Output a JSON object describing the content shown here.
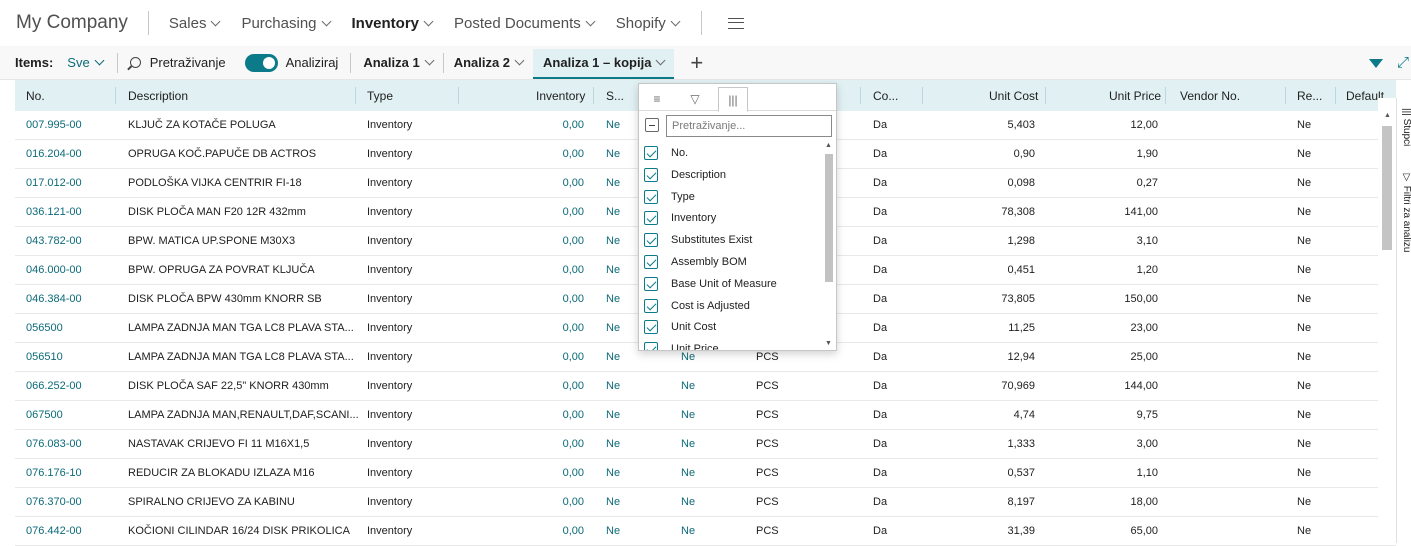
{
  "company": "My Company",
  "nav": [
    {
      "label": "Sales",
      "active": false
    },
    {
      "label": "Purchasing",
      "active": false
    },
    {
      "label": "Inventory",
      "active": true
    },
    {
      "label": "Posted Documents",
      "active": false
    },
    {
      "label": "Shopify",
      "active": false
    }
  ],
  "actionbar": {
    "label": "Items:",
    "filter": "Sve",
    "search": "Pretraživanje",
    "analyze": "Analiziraj",
    "tabs": [
      "Analiza 1",
      "Analiza 2",
      "Analiza 1 – kopija"
    ],
    "add": "+"
  },
  "table": {
    "headers": [
      "No.",
      "Description",
      "Type",
      "Inventory",
      "S...",
      "Co...",
      "Unit Cost",
      "Unit Price",
      "Vendor No.",
      "Re...",
      "Default"
    ],
    "rows": [
      {
        "no": "007.995-00",
        "desc": "KLJUČ ZA KOTAČE POLUGA",
        "type": "Inventory",
        "inv": "0,00",
        "s": "Ne",
        "a": "",
        "u": "",
        "co": "Da",
        "cost": "5,403",
        "price": "12,00",
        "re": "Ne"
      },
      {
        "no": "016.204-00",
        "desc": "OPRUGA KOČ.PAPUČE DB ACTROS",
        "type": "Inventory",
        "inv": "0,00",
        "s": "Ne",
        "a": "",
        "u": "",
        "co": "Da",
        "cost": "0,90",
        "price": "1,90",
        "re": "Ne"
      },
      {
        "no": "017.012-00",
        "desc": "PODLOŠKA VIJKA CENTRIR FI-18",
        "type": "Inventory",
        "inv": "0,00",
        "s": "Ne",
        "a": "",
        "u": "",
        "co": "Da",
        "cost": "0,098",
        "price": "0,27",
        "re": "Ne"
      },
      {
        "no": "036.121-00",
        "desc": "DISK PLOČA MAN F20 12R 432mm",
        "type": "Inventory",
        "inv": "0,00",
        "s": "Ne",
        "a": "",
        "u": "",
        "co": "Da",
        "cost": "78,308",
        "price": "141,00",
        "re": "Ne"
      },
      {
        "no": "043.782-00",
        "desc": "BPW. MATICA UP.SPONE M30X3",
        "type": "Inventory",
        "inv": "0,00",
        "s": "Ne",
        "a": "",
        "u": "",
        "co": "Da",
        "cost": "1,298",
        "price": "3,10",
        "re": "Ne"
      },
      {
        "no": "046.000-00",
        "desc": "BPW. OPRUGA ZA POVRAT KLJUČA",
        "type": "Inventory",
        "inv": "0,00",
        "s": "Ne",
        "a": "",
        "u": "",
        "co": "Da",
        "cost": "0,451",
        "price": "1,20",
        "re": "Ne"
      },
      {
        "no": "046.384-00",
        "desc": "DISK PLOČA BPW 430mm KNORR SB",
        "type": "Inventory",
        "inv": "0,00",
        "s": "Ne",
        "a": "",
        "u": "",
        "co": "Da",
        "cost": "73,805",
        "price": "150,00",
        "re": "Ne"
      },
      {
        "no": "056500",
        "desc": "LAMPA ZADNJA MAN TGA LC8 PLAVA STA...",
        "type": "Inventory",
        "inv": "0,00",
        "s": "Ne",
        "a": "",
        "u": "",
        "co": "Da",
        "cost": "11,25",
        "price": "23,00",
        "re": "Ne"
      },
      {
        "no": "056510",
        "desc": "LAMPA ZADNJA MAN TGA LC8 PLAVA STA...",
        "type": "Inventory",
        "inv": "0,00",
        "s": "Ne",
        "a": "Ne",
        "u": "PCS",
        "co": "Da",
        "cost": "12,94",
        "price": "25,00",
        "re": "Ne"
      },
      {
        "no": "066.252-00",
        "desc": "DISK PLOČA SAF 22,5\" KNORR 430mm",
        "type": "Inventory",
        "inv": "0,00",
        "s": "Ne",
        "a": "Ne",
        "u": "PCS",
        "co": "Da",
        "cost": "70,969",
        "price": "144,00",
        "re": "Ne"
      },
      {
        "no": "067500",
        "desc": "LAMPA ZADNJA MAN,RENAULT,DAF,SCANI...",
        "type": "Inventory",
        "inv": "0,00",
        "s": "Ne",
        "a": "Ne",
        "u": "PCS",
        "co": "Da",
        "cost": "4,74",
        "price": "9,75",
        "re": "Ne"
      },
      {
        "no": "076.083-00",
        "desc": "NASTAVAK CRIJEVO FI 11 M16X1,5",
        "type": "Inventory",
        "inv": "0,00",
        "s": "Ne",
        "a": "Ne",
        "u": "PCS",
        "co": "Da",
        "cost": "1,333",
        "price": "3,00",
        "re": "Ne"
      },
      {
        "no": "076.176-10",
        "desc": "REDUCIR ZA BLOKADU IZLAZA M16",
        "type": "Inventory",
        "inv": "0,00",
        "s": "Ne",
        "a": "Ne",
        "u": "PCS",
        "co": "Da",
        "cost": "0,537",
        "price": "1,10",
        "re": "Ne"
      },
      {
        "no": "076.370-00",
        "desc": "SPIRALNO CRIJEVO ZA KABINU",
        "type": "Inventory",
        "inv": "0,00",
        "s": "Ne",
        "a": "Ne",
        "u": "PCS",
        "co": "Da",
        "cost": "8,197",
        "price": "18,00",
        "re": "Ne"
      },
      {
        "no": "076.442-00",
        "desc": "KOČIONI CILINDAR 16/24 DISK PRIKOLICA",
        "type": "Inventory",
        "inv": "0,00",
        "s": "Ne",
        "a": "Ne",
        "u": "PCS",
        "co": "Da",
        "cost": "31,39",
        "price": "65,00",
        "re": "Ne"
      }
    ]
  },
  "popup": {
    "search_placeholder": "Pretraživanje...",
    "items": [
      "No.",
      "Description",
      "Type",
      "Inventory",
      "Substitutes Exist",
      "Assembly BOM",
      "Base Unit of Measure",
      "Cost is Adjusted",
      "Unit Cost",
      "Unit Price"
    ]
  },
  "sidebar": {
    "columns": "Stupci",
    "filters": "Filtri za analizu"
  },
  "colors": {
    "accent": "#0b7a89",
    "link": "#0b6a78",
    "header_bg": "#e1f1f3"
  }
}
